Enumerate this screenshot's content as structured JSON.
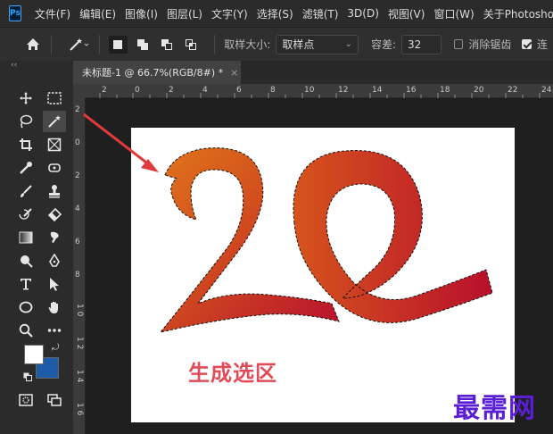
{
  "app": {
    "logo": "Ps",
    "menu": [
      "文件(F)",
      "编辑(E)",
      "图像(I)",
      "图层(L)",
      "文字(Y)",
      "选择(S)",
      "滤镜(T)",
      "3D(D)",
      "视图(V)",
      "窗口(W)",
      "关于Photoshop"
    ]
  },
  "options_bar": {
    "home_icon": "home-icon",
    "tool_icon": "magic-wand-icon",
    "sample_size_label": "取样大小:",
    "sample_size_value": "取样点",
    "tolerance_label": "容差:",
    "tolerance_value": "32",
    "anti_alias_label": "消除锯齿",
    "anti_alias_checked": false,
    "contiguous_checked": true,
    "contiguous_label_partial": "连"
  },
  "document": {
    "tab_title": "未标题-1 @ 66.7%(RGB/8#) *",
    "close_glyph": "×"
  },
  "rulers": {
    "top_ticks": [
      "2",
      "0",
      "2",
      "4",
      "6",
      "8",
      "10",
      "12",
      "14",
      "16",
      "18",
      "20",
      "22",
      "24"
    ],
    "left_ticks": [
      "2",
      "0",
      "2",
      "4",
      "6",
      "8",
      "1 0",
      "1 2",
      "1 4",
      "1 6"
    ]
  },
  "canvas": {
    "caption": "生成选区",
    "watermark": "最需网",
    "caption_color": "#e04c5a",
    "watermark_color": "#5a1fd4",
    "arrow_color": "#e0393e"
  },
  "colors": {
    "foreground": "#ffffff",
    "background": "#1f5ca8"
  }
}
